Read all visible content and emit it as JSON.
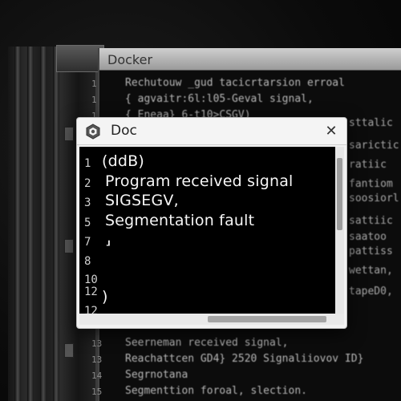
{
  "background_window": {
    "title": "Docker",
    "line_numbers": [
      "1",
      "1",
      "1",
      "13",
      "13",
      "14",
      "15"
    ],
    "code_lines": [
      "Rechutouw _gud tacicrtarsion erroal",
      "{   agvaitr:6l:l05-Geval signal,",
      "{   Eneaa} 6-t10>CSGV)",
      "Seerneman received signal,",
      "Reachattcen GD4} 2520 Signaliiovov ID}",
      "Segrnotana",
      "Segmenttion foroal, slection."
    ],
    "right_fragments": [
      "sttalic",
      "sarictic",
      "ratiic",
      "fantiom",
      "soosiorl",
      "sattiic",
      "saatoo",
      "pattiss",
      "wettan,",
      "tapeD0,"
    ]
  },
  "dialog": {
    "title": "Doc",
    "close_label": "✕",
    "line_numbers": [
      "1",
      "2",
      "3",
      "5",
      "7",
      "8",
      "10",
      "12",
      "12"
    ],
    "lines": [
      "(ddB)",
      " Program received signal",
      " SIGSEGV,",
      " Segmentation fault",
      " ⸥",
      "",
      "",
      "",
      ")"
    ]
  },
  "icons": {
    "dialog_icon": "docker-hex-icon",
    "close": "close-icon"
  }
}
